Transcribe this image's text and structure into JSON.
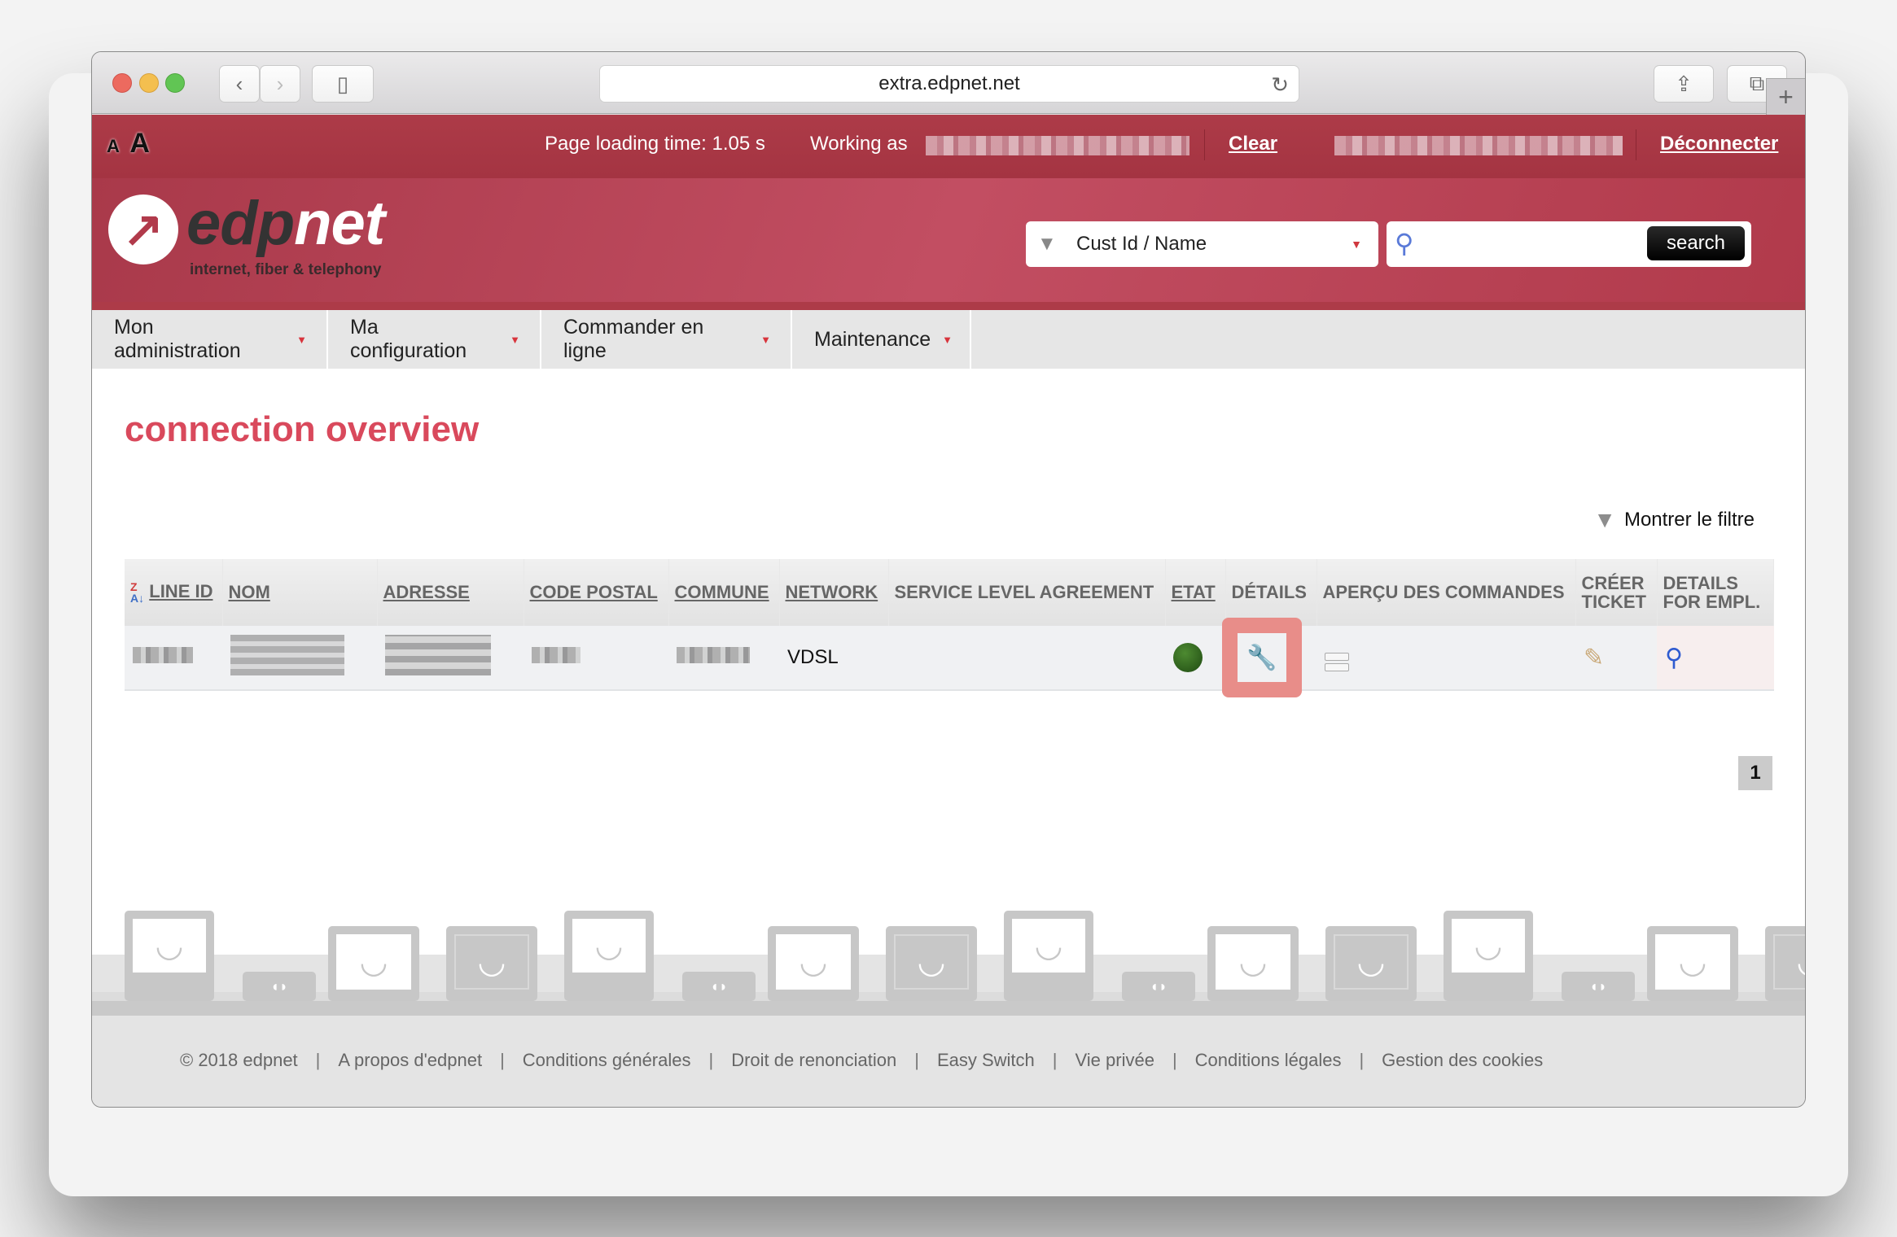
{
  "browser": {
    "url": "extra.edpnet.net",
    "buttons": {
      "back": "‹",
      "forward": "›",
      "sidebar": "▯",
      "reload": "↻",
      "share": "⇪",
      "tabs": "⧉",
      "new_tab": "+"
    }
  },
  "topbar": {
    "font_small": "A",
    "font_large": "A",
    "page_loading": "Page loading time: 1.05 s",
    "working_as_label": "Working as",
    "clear_link": "Clear",
    "logout_link": "Déconnecter"
  },
  "header": {
    "logo_text_dark": "edp",
    "logo_text_light": "net",
    "logo_tagline": "internet, fiber & telephony",
    "search_filter_selected": "Cust Id / Name",
    "search_placeholder": "",
    "search_button": "search"
  },
  "nav": {
    "items": [
      {
        "label": "Mon administration"
      },
      {
        "label": "Ma configuration"
      },
      {
        "label": "Commander en ligne"
      },
      {
        "label": "Maintenance"
      }
    ]
  },
  "main": {
    "title": "connection overview",
    "show_filter": "Montrer le filtre",
    "table": {
      "columns": [
        {
          "label": "LINE ID",
          "sortable": true
        },
        {
          "label": "NOM",
          "sortable": true
        },
        {
          "label": "ADRESSE",
          "sortable": true
        },
        {
          "label": "CODE POSTAL",
          "sortable": true
        },
        {
          "label": "COMMUNE",
          "sortable": true
        },
        {
          "label": "NETWORK",
          "sortable": true
        },
        {
          "label": "SERVICE LEVEL AGREEMENT",
          "sortable": false
        },
        {
          "label": "ETAT",
          "sortable": true
        },
        {
          "label": "DÉTAILS",
          "sortable": false
        },
        {
          "label": "APERÇU DES COMMANDES",
          "sortable": false
        },
        {
          "label": "CRÉER TICKET",
          "sortable": false
        },
        {
          "label": "DETAILS FOR EMPL.",
          "sortable": false
        }
      ],
      "rows": [
        {
          "line_id": "[redacted]",
          "nom": "[redacted]",
          "adresse": "[redacted]",
          "code_postal": "[redacted]",
          "commune": "[redacted]",
          "network": "VDSL",
          "sla": "",
          "etat": "active",
          "etat_color": "#2f6a1e"
        }
      ]
    },
    "pagination": {
      "current_page": "1"
    }
  },
  "footer": {
    "links": [
      "© 2018 edpnet",
      "A propos d'edpnet",
      "Conditions générales",
      "Droit de renonciation",
      "Easy Switch",
      "Vie privée",
      "Conditions légales",
      "Gestion des cookies"
    ]
  },
  "colors": {
    "brand": "#ad3b48",
    "title": "#d9495c",
    "highlight": "#e88d89"
  }
}
